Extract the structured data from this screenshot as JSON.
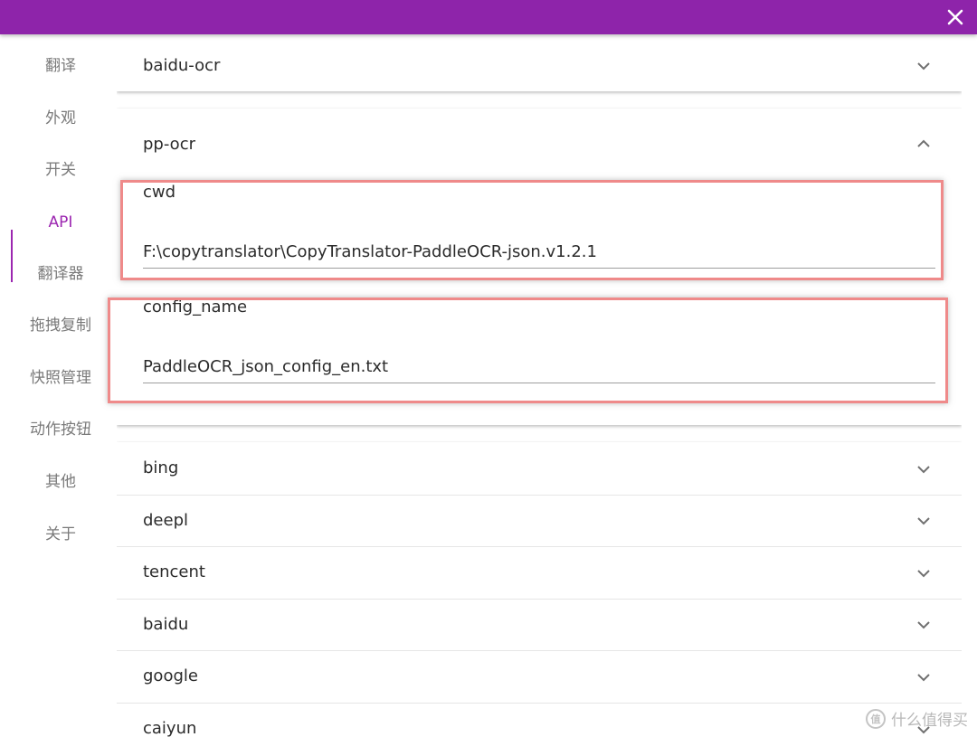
{
  "window": {
    "close_glyph": "✕"
  },
  "sidebar": {
    "items": [
      {
        "label": "翻译"
      },
      {
        "label": "外观"
      },
      {
        "label": "开关"
      },
      {
        "label": "API"
      },
      {
        "label": "翻译器"
      },
      {
        "label": "拖拽复制"
      },
      {
        "label": "快照管理"
      },
      {
        "label": "动作按钮"
      },
      {
        "label": "其他"
      },
      {
        "label": "关于"
      }
    ]
  },
  "panels": {
    "baidu_ocr": {
      "title": "baidu-ocr"
    },
    "pp_ocr": {
      "title": "pp-ocr",
      "cwd": {
        "label": "cwd",
        "value": "F:\\copytranslator\\CopyTranslator-PaddleOCR-json.v1.2.1"
      },
      "config_name": {
        "label": "config_name",
        "value": "PaddleOCR_json_config_en.txt"
      }
    },
    "list": [
      {
        "title": "bing"
      },
      {
        "title": "deepl"
      },
      {
        "title": "tencent"
      },
      {
        "title": "baidu"
      },
      {
        "title": "google"
      },
      {
        "title": "caiyun"
      }
    ]
  },
  "colors": {
    "topbar": "#8e24aa",
    "accent": "#9c27b0",
    "highlight": "#ef8a8a"
  },
  "watermark": {
    "badge": "值",
    "text": "什么值得买"
  }
}
